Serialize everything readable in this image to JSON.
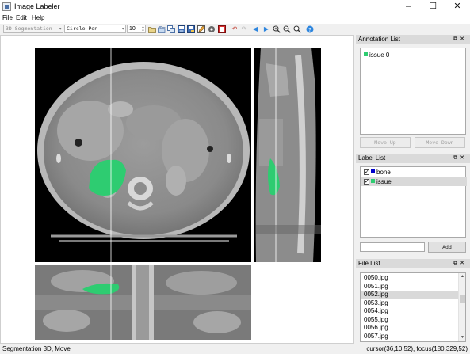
{
  "window": {
    "title": "Image Labeler",
    "controls": [
      "–",
      "☐",
      "✕"
    ]
  },
  "menu": [
    "File",
    "Edit",
    "Help"
  ],
  "toolbar": {
    "mode_combo": "3D Segmentation",
    "tool_combo": "Circle Pen",
    "pen_size": "10",
    "icons": [
      "open-folder-icon",
      "open-files-icon",
      "copy-icon",
      "save-icon",
      "save-as-icon",
      "edit-icon",
      "settings-icon",
      "delete-icon",
      "undo-icon",
      "redo-icon",
      "previous-icon",
      "next-icon",
      "zoom-in-icon",
      "zoom-out-icon",
      "zoom-fit-icon",
      "help-icon"
    ]
  },
  "annotation_list": {
    "title": "Annotation List",
    "items": [
      {
        "label": "issue 0",
        "color": "#2ecc71"
      }
    ],
    "move_up": "Move Up",
    "move_down": "Move Down"
  },
  "label_list": {
    "title": "Label List",
    "items": [
      {
        "label": "bone",
        "color": "#0000cc",
        "checked": true,
        "selected": false
      },
      {
        "label": "issue",
        "color": "#2ecc71",
        "checked": true,
        "selected": true
      }
    ],
    "input_placeholder": "",
    "add": "Add"
  },
  "file_list": {
    "title": "File List",
    "items": [
      "0050.jpg",
      "0051.jpg",
      "0052.jpg",
      "0053.jpg",
      "0054.jpg",
      "0055.jpg",
      "0056.jpg",
      "0057.jpg"
    ],
    "selected_index": 2
  },
  "status": {
    "left": "Segmentation 3D, Move",
    "right": "cursor(36,10,52), focus(180,329,52)"
  },
  "colors": {
    "segmentation": "#2ecc71",
    "crosshair": "#ffffff"
  }
}
